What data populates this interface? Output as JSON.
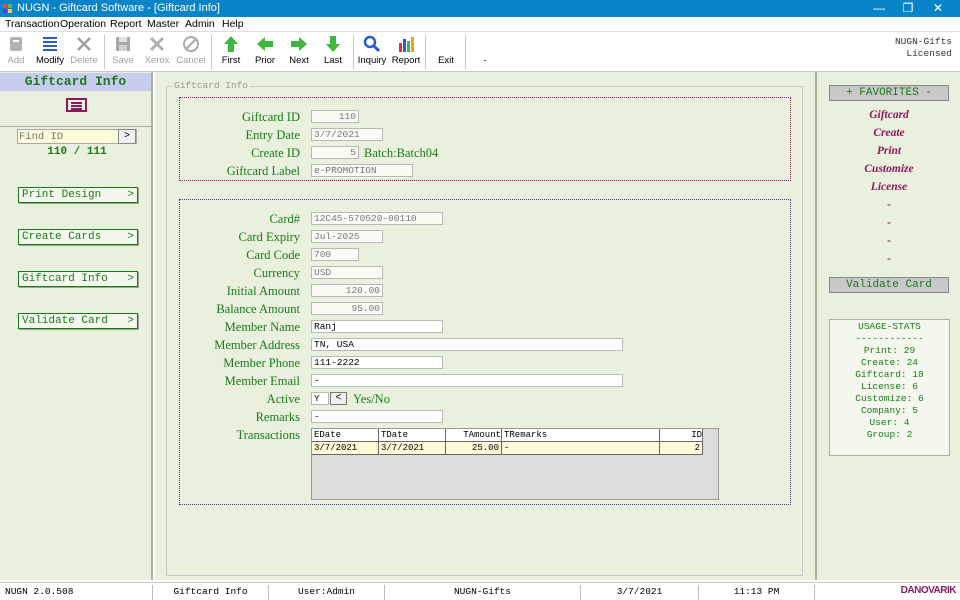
{
  "window": {
    "title": "NUGN - Giftcard Software - [Giftcard Info]",
    "controls": [
      "—",
      "❐",
      "✕"
    ]
  },
  "menu": [
    "Transaction",
    "Operation",
    "Report",
    "Master",
    "Admin",
    "Help"
  ],
  "toolbar": {
    "add": "Add",
    "modify": "Modify",
    "delete": "Delete",
    "save": "Save",
    "xerox": "Xerox",
    "cancel": "Cancel",
    "first": "First",
    "prior": "Prior",
    "next": "Next",
    "last": "Last",
    "inquiry": "Inquiry",
    "report": "Report",
    "exit": "Exit",
    "dash": "-",
    "info_line1": "NUGN-Gifts",
    "info_line2": "Licensed"
  },
  "left": {
    "title": "Giftcard Info",
    "find_placeholder": "Find ID",
    "find_go": ">",
    "counter": "110 / 111",
    "buttons": [
      {
        "label": "Print Design",
        "arrow": ">"
      },
      {
        "label": "Create Cards",
        "arrow": ">"
      },
      {
        "label": "Giftcard Info",
        "arrow": ">"
      },
      {
        "label": "Validate Card",
        "arrow": ">"
      }
    ]
  },
  "form": {
    "group_title": "Giftcard Info",
    "giftcard_id_label": "Giftcard ID",
    "giftcard_id": "110",
    "entry_date_label": "Entry Date",
    "entry_date": "3/7/2021",
    "create_id_label": "Create ID",
    "create_id": "5",
    "batch": "Batch:Batch04",
    "giftcard_label_label": "Giftcard Label",
    "giftcard_label": "e-PROMOTION",
    "card_no_label": "Card#",
    "card_no": "12C45-570520-00110",
    "card_expiry_label": "Card Expiry",
    "card_expiry": "Jul-2025",
    "card_code_label": "Card Code",
    "card_code": "700",
    "currency_label": "Currency",
    "currency": "USD",
    "initial_amount_label": "Initial Amount",
    "initial_amount": "120.00",
    "balance_amount_label": "Balance Amount",
    "balance_amount": "95.00",
    "member_name_label": "Member Name",
    "member_name": "Ranj",
    "member_address_label": "Member Address",
    "member_address": "TN, USA",
    "member_phone_label": "Member Phone",
    "member_phone": "111-2222",
    "member_email_label": "Member Email",
    "member_email": "-",
    "active_label": "Active",
    "active": "Y",
    "active_btn": "<",
    "active_hint": "Yes/No",
    "remarks_label": "Remarks",
    "remarks": "-",
    "transactions_label": "Transactions"
  },
  "transactions": {
    "columns": [
      "EDate",
      "TDate",
      "TAmount",
      "TRemarks",
      "ID"
    ],
    "rows": [
      [
        "3/7/2021",
        "3/7/2021",
        "25.00",
        "-",
        "2"
      ]
    ]
  },
  "right": {
    "favorites_title": "+ FAVORITES -",
    "favorites": [
      "Giftcard",
      "Create",
      "Print",
      "Customize",
      "License",
      "-",
      "-",
      "-",
      "-"
    ],
    "validate": "Validate Card",
    "stats": [
      "USAGE-STATS",
      "------------",
      "Print: 29",
      "Create: 24",
      "Giftcard: 18",
      "License: 6",
      "Customize: 6",
      "Company: 5",
      "User: 4",
      "Group: 2"
    ]
  },
  "status": {
    "version": "NUGN 2.0.508",
    "screen": "Giftcard Info",
    "user": "User:Admin",
    "product": "NUGN-Gifts",
    "date": "3/7/2021",
    "time": "11:13 PM",
    "logo": "DANOVARIK"
  },
  "colors": {
    "titlebar": "#0a84c8",
    "panel_bg": "#e9f0dd",
    "label_green": "#1a7a1a",
    "accent_maroon": "#8b1a5a"
  }
}
